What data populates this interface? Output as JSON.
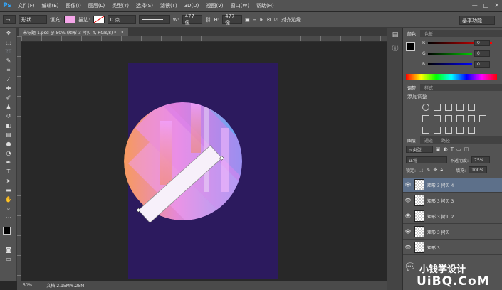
{
  "app": {
    "logo": "Ps"
  },
  "menu": [
    "文件(F)",
    "编辑(E)",
    "图像(I)",
    "图层(L)",
    "类型(Y)",
    "选择(S)",
    "滤镜(T)",
    "3D(D)",
    "视图(V)",
    "窗口(W)",
    "帮助(H)"
  ],
  "window_controls": [
    "—",
    "□",
    "✕"
  ],
  "options": {
    "shape_mode": "形状",
    "fill_label": "填充:",
    "fill_color": "#f5a6e9",
    "stroke_label": "描边:",
    "stroke_width": "0 点",
    "width_label": "W:",
    "width_value": "477 像",
    "height_label": "H:",
    "height_value": "477 像",
    "align_edges_label": "对齐边缘",
    "workspace": "基本功能"
  },
  "document": {
    "tab_title": "未标题-1.psd @ 50% (矩形 3 拷贝 4, RGB/8) *",
    "tab_close": "×",
    "zoom": "50%",
    "doc_info": "文档:2.15M/6.25M"
  },
  "colors": {
    "canvas_bg": "#2c1a5e",
    "circle_gradient_start": "#f79a5e",
    "circle_gradient_end": "#5aa8f7",
    "stripe_pink": "#e98ef0",
    "accent_blue": "#31a8ff"
  },
  "color_panel": {
    "tabs": [
      "颜色",
      "色板"
    ],
    "r_label": "R",
    "r_value": "0",
    "g_label": "G",
    "g_value": "0",
    "b_label": "B",
    "b_value": "0"
  },
  "adjust_panel": {
    "tabs": [
      "调整",
      "样式"
    ],
    "title": "添加调整"
  },
  "layers_panel": {
    "tabs": [
      "图层",
      "通道",
      "路径"
    ],
    "filter_label": "ρ 类型",
    "blend_mode": "正常",
    "opacity_label": "不透明度:",
    "opacity_value": "75%",
    "lock_label": "锁定:",
    "fill_label": "填充:",
    "fill_value": "100%",
    "layers": [
      {
        "name": "矩形 3 拷贝 4",
        "selected": true
      },
      {
        "name": "矩形 3 拷贝 3",
        "selected": false
      },
      {
        "name": "矩形 3 拷贝 2",
        "selected": false
      },
      {
        "name": "矩形 3 拷贝",
        "selected": false
      },
      {
        "name": "矩形 3",
        "selected": false
      }
    ]
  },
  "watermark": {
    "text": "小钱学设计",
    "brand": "UiBQ.CoM"
  }
}
